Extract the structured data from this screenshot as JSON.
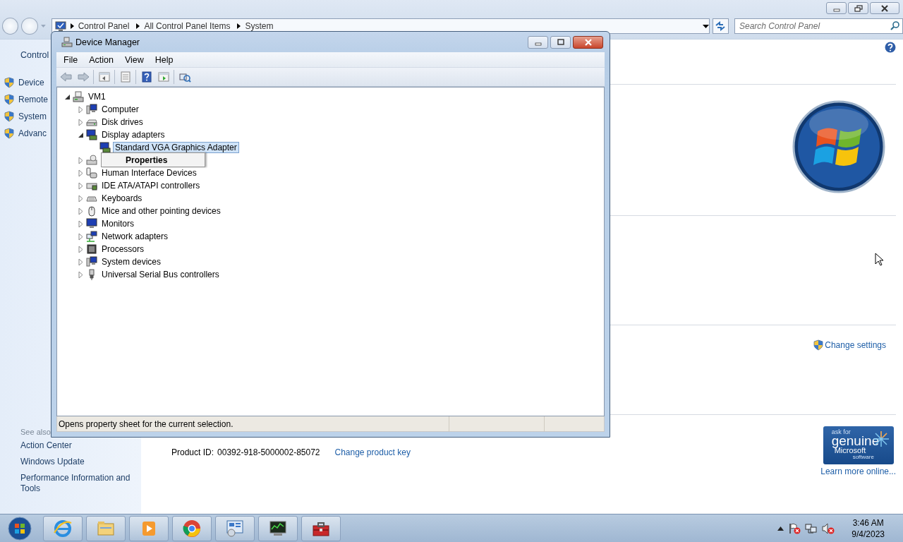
{
  "explorer": {
    "breadcrumbs": [
      "Control Panel",
      "All Control Panel Items",
      "System"
    ],
    "search": {
      "placeholder": "Search Control Panel"
    }
  },
  "sidebar": {
    "header": "Control",
    "items": [
      "Device",
      "Remote",
      "System",
      "Advanc"
    ],
    "see_also": {
      "title": "See also",
      "items": [
        "Action Center",
        "Windows Update",
        "Performance Information and Tools"
      ]
    }
  },
  "main": {
    "change_settings": "Change settings",
    "product_id_label": "Product ID:",
    "product_id": "00392-918-5000002-85072",
    "change_key": "Change product key",
    "genuine_badge": [
      "ask for",
      "genuine",
      "Microsoft",
      "software"
    ],
    "learn_more": "Learn more online..."
  },
  "device_manager": {
    "title": "Device Manager",
    "menu": [
      "File",
      "Action",
      "View",
      "Help"
    ],
    "tree": {
      "label": "VM1",
      "expanded": true,
      "selected": false,
      "children": [
        {
          "label": "Computer",
          "expanded": false,
          "selected": false
        },
        {
          "label": "Disk drives",
          "expanded": false,
          "selected": false
        },
        {
          "label": "Display adapters",
          "expanded": true,
          "selected": false,
          "children": [
            {
              "label": "Standard VGA Graphics Adapter",
              "selected": true
            }
          ]
        },
        {
          "expanded": false,
          "selected": false
        },
        {
          "label": "Human Interface Devices",
          "expanded": false,
          "selected": false
        },
        {
          "label": "IDE ATA/ATAPI controllers",
          "expanded": false,
          "selected": false
        },
        {
          "label": "Keyboards",
          "expanded": false,
          "selected": false
        },
        {
          "label": "Mice and other pointing devices",
          "expanded": false,
          "selected": false
        },
        {
          "label": "Monitors",
          "expanded": false,
          "selected": false
        },
        {
          "label": "Network adapters",
          "expanded": false,
          "selected": false
        },
        {
          "label": "Processors",
          "expanded": false,
          "selected": false
        },
        {
          "label": "System devices",
          "expanded": false,
          "selected": false
        },
        {
          "label": "Universal Serial Bus controllers",
          "expanded": false,
          "selected": false
        }
      ]
    },
    "context_menu": [
      "Properties"
    ],
    "status": "Opens property sheet for the current selection."
  },
  "taskbar": {
    "time": "3:46 AM",
    "date": "9/4/2023"
  }
}
